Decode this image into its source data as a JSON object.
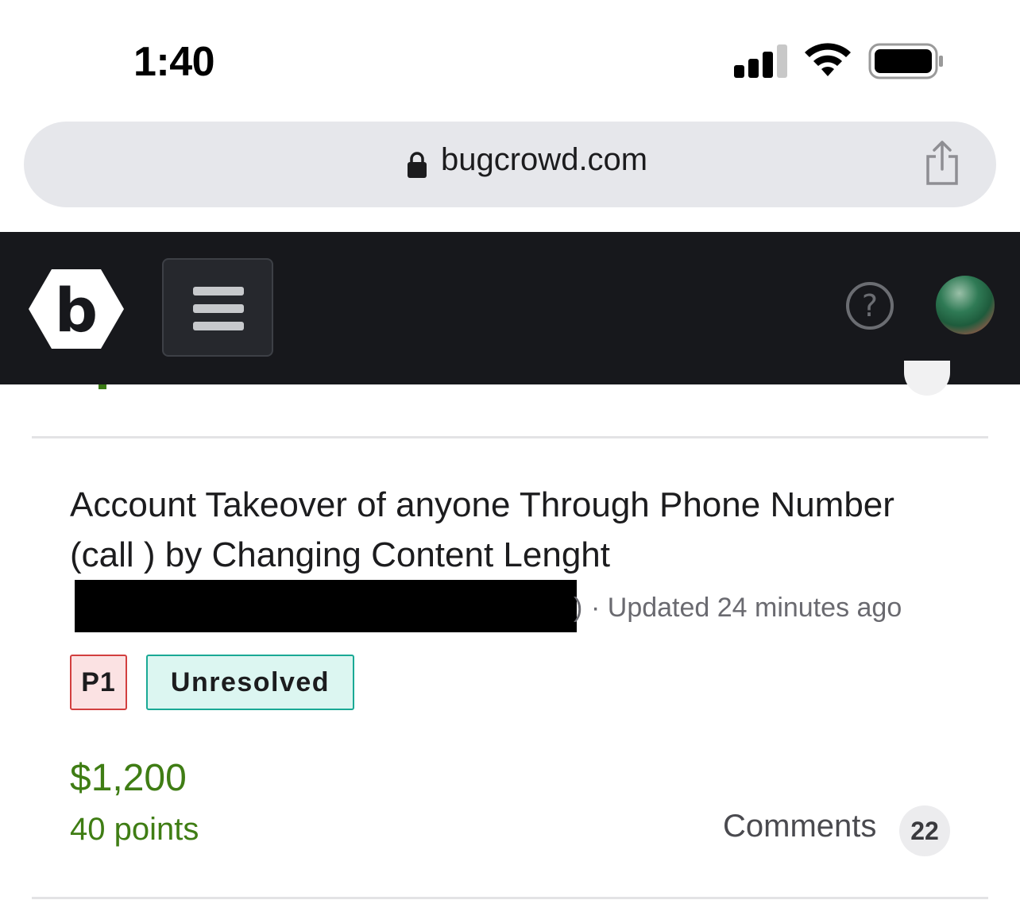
{
  "status_bar": {
    "time": "1:40"
  },
  "browser": {
    "url": "bugcrowd.com"
  },
  "report": {
    "title": "Account Takeover of anyone Through Phone Number (call ) by Changing Content Lenght",
    "redaction_tail": ")",
    "meta": "· Updated 24 minutes ago",
    "priority": "P1",
    "status": "Unresolved",
    "reward": "$1,200",
    "points": "40 points",
    "comments_label": "Comments",
    "comments_count": "22"
  },
  "colors": {
    "header_bg": "#17181c",
    "reward_green": "#3f7d14",
    "priority_border": "#d23f3f",
    "status_border": "#1aa995"
  },
  "icons": [
    "lock-icon",
    "share-icon",
    "bugcrowd-logo",
    "hamburger-menu-icon",
    "help-icon",
    "signal-icon",
    "wifi-icon",
    "battery-icon"
  ]
}
